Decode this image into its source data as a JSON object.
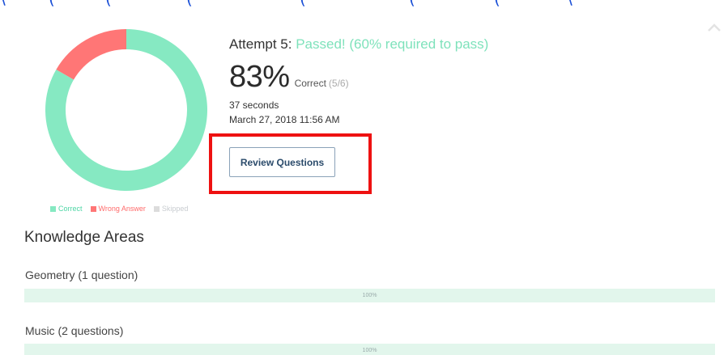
{
  "attempt": {
    "prefix": "Attempt 5:",
    "status": "Passed! (60% required to pass)"
  },
  "score": {
    "percent": "83%",
    "label": "Correct",
    "fraction": "(5/6)",
    "correct": 5,
    "wrong": 1,
    "skipped": 0,
    "total": 6
  },
  "duration": "37 seconds",
  "date": "March 27, 2018 11:56 AM",
  "review_button": "Review Questions",
  "legend": {
    "correct": "Correct",
    "wrong": "Wrong Answer",
    "skipped": "Skipped"
  },
  "knowledge_areas": {
    "heading": "Knowledge Areas",
    "items": [
      {
        "label": "Geometry (1 question)",
        "percent_text": "100%",
        "fraction": 1.0
      },
      {
        "label": "Music (2 questions)",
        "percent_text": "100%",
        "fraction": 1.0
      }
    ]
  },
  "colors": {
    "correct": "#86e9c2",
    "wrong": "#ff7676",
    "skipped": "#dcdcdc",
    "pass_text": "#7ee2bb",
    "highlight": "#ee1111"
  },
  "icons": {
    "collapse": "chevron-up-icon"
  }
}
